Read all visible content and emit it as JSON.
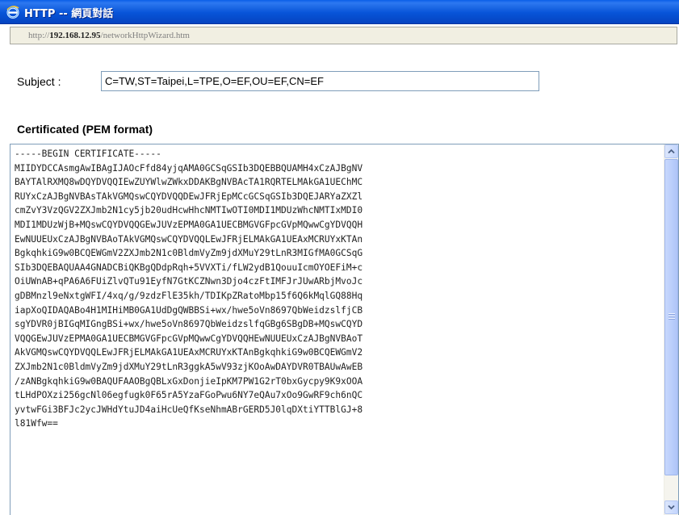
{
  "window": {
    "title": "HTTP -- 網頁對話",
    "icon": "ie-icon"
  },
  "address": {
    "prefix": "http://",
    "host": "192.168.12.95",
    "path": "/networkHttpWizard.htm"
  },
  "form": {
    "subject_label": "Subject :",
    "subject_value": "C=TW,ST=Taipei,L=TPE,O=EF,OU=EF,CN=EF",
    "cert_label": "Certificated (PEM format)",
    "cert_text": "-----BEGIN CERTIFICATE-----\nMIIDYDCCAsmgAwIBAgIJAOcFfd84yjqAMA0GCSqGSIb3DQEBBQUAMH4xCzAJBgNV\nBAYTAlRXMQ8wDQYDVQQIEwZUYWlwZWkxDDAKBgNVBAcTA1RQRTELMAkGA1UEChMC\nRUYxCzAJBgNVBAsTAkVGMQswCQYDVQQDEwJFRjEpMCcGCSqGSIb3DQEJARYaZXZl\ncmZvY3VzQGV2ZXJmb2N1cy5jb20udHcwHhcNMTIwOTI0MDI1MDUzWhcNMTIxMDI0\nMDI1MDUzWjB+MQswCQYDVQQGEwJUVzEPMA0GA1UECBMGVGFpcGVpMQwwCgYDVQQH\nEwNUUEUxCzAJBgNVBAoTAkVGMQswCQYDVQQLEwJFRjELMAkGA1UEAxMCRUYxKTAn\nBgkqhkiG9w0BCQEWGmV2ZXJmb2N1c0BldmVyZm9jdXMuY29tLnR3MIGfMA0GCSqG\nSIb3DQEBAQUAA4GNADCBiQKBgQDdpRqh+5VVXTi/fLW2ydB1QouuIcmOYOEFiM+c\nOiUWnAB+qPA6A6FUiZlvQTu91EyfN7GtKCZNwn3Djo4czFtIMFJrJUwARbjMvoJc\ngDBMnzl9eNxtgWFI/4xq/g/9zdzFlE35kh/TDIKpZRatoMbp15f6Q6kMqlGQ88Hq\niapXoQIDAQABo4H1MIHiMB0GA1UdDgQWBBSi+wx/hwe5oVn8697QbWeidzslfjCB\nsgYDVR0jBIGqMIGngBSi+wx/hwe5oVn8697QbWeidzslfqGBg6SBgDB+MQswCQYD\nVQQGEwJUVzEPMA0GA1UECBMGVGFpcGVpMQwwCgYDVQQHEwNUUEUxCzAJBgNVBAoT\nAkVGMQswCQYDVQQLEwJFRjELMAkGA1UEAxMCRUYxKTAnBgkqhkiG9w0BCQEWGmV2\nZXJmb2N1c0BldmVyZm9jdXMuY29tLnR3ggkA5wV93zjKOoAwDAYDVR0TBAUwAwEB\n/zANBgkqhkiG9w0BAQUFAAOBgQBLxGxDonjieIpKM7PW1G2rT0bxGycpy9K9xOOA\ntLHdPOXzi256gcNl06egfugk0F65rA5YzaFGoPwu6NY7eQAu7xOo9GwRF9ch6nQC\nyvtwFGi3BFJc2ycJWHdYtuJD4aiHcUeQfKseNhmABrGERD5J0lqDXtiYTTBlGJ+8\nl81Wfw=="
  },
  "scrollbar": {
    "position": 0.0
  }
}
